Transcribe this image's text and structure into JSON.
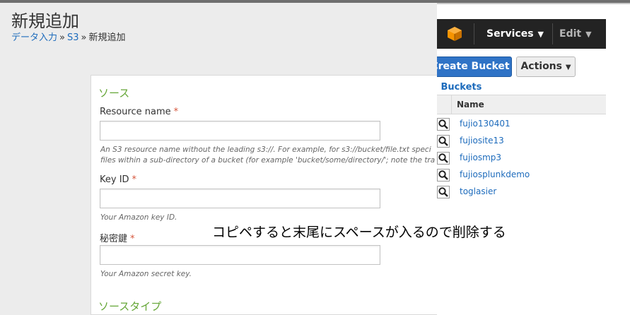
{
  "colors": {
    "aws_navbar": "#232323",
    "aws_logo": "#f79400",
    "create_button": "#2f73c6",
    "link": "#1d6bbc",
    "section_title": "#65a637",
    "required": "#d6563c"
  },
  "aws": {
    "navbar": {
      "logo_icon": "aws-cube-icon",
      "services_label": "Services",
      "edit_label": "Edit"
    },
    "create_bucket_label": "Create Bucket",
    "actions_label": "Actions",
    "all_buckets_label": "ll Buckets",
    "table": {
      "name_header": "Name",
      "buckets": [
        "fujio130401",
        "fujiosite13",
        "fujiosmp3",
        "fujiosplunkdemo",
        "toglasier"
      ]
    }
  },
  "splunk": {
    "page_title": "新規追加",
    "breadcrumb": {
      "item1": "データ入力",
      "item2": "S3",
      "current": "新規追加",
      "separator": "»"
    },
    "form": {
      "section_source": "ソース",
      "resource_name_label": "Resource name",
      "resource_name_help1": "An S3 resource name without the leading s3://. For example, for s3://bucket/file.txt speci",
      "resource_name_help2": "files within a sub-directory of a bucket (for example 'bucket/some/directory/'; note the tra",
      "key_id_label": "Key ID",
      "key_id_help": "Your Amazon key ID.",
      "secret_key_label": "秘密鍵",
      "secret_key_help": "Your Amazon secret key.",
      "section_source_type": "ソースタイプ",
      "required_mark": "*"
    }
  },
  "annotation": "コピペすると末尾にスペースが入るので削除する"
}
